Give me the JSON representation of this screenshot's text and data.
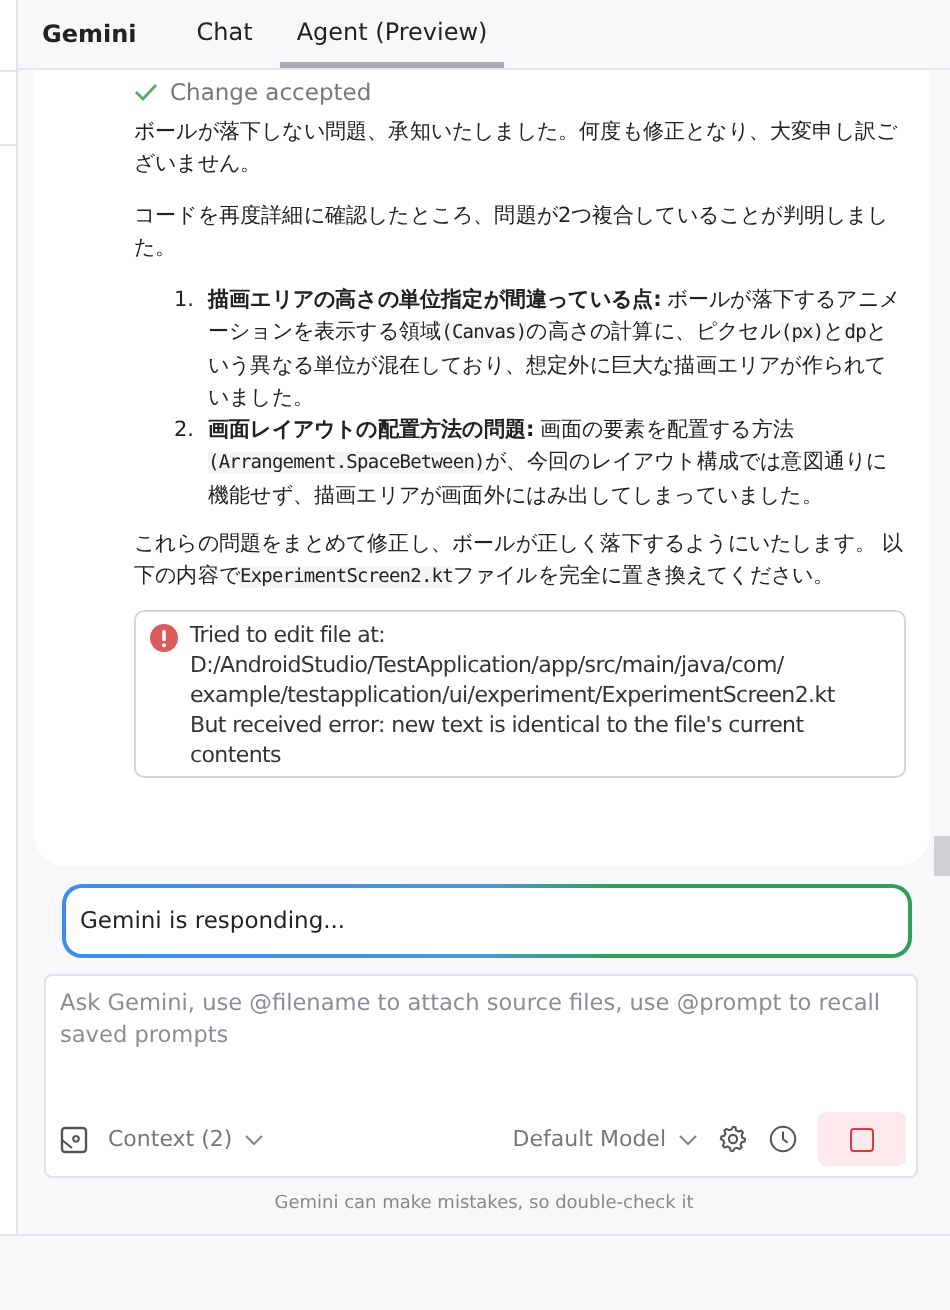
{
  "panel_title": "Gemini",
  "tabs": [
    {
      "label": "Chat",
      "selected": false
    },
    {
      "label": "Agent (Preview)",
      "selected": true
    }
  ],
  "status": {
    "kind": "success",
    "text": "Change accepted"
  },
  "blocks": [
    {
      "kind": "paragraph",
      "segments": [
        {
          "kind": "text",
          "text": "ボールが落下しない問題、承知いたしました。何度も修正となり、大変申し訳ございません。"
        }
      ]
    },
    {
      "kind": "paragraph",
      "segments": [
        {
          "kind": "text",
          "text": "コードを再度詳細に確認したところ、問題が2つ複合していることが判明しました。"
        }
      ]
    },
    {
      "kind": "list",
      "items": [
        {
          "number": "1.",
          "segments": [
            {
              "kind": "text",
              "text": "**描画エリアの高さの単位指定が間違っている点:** ボールが落下するアニメーションを表示する領域"
            },
            {
              "kind": "code",
              "text": "(Canvas)"
            },
            {
              "kind": "text",
              "text": "の高さの計算に、ピクセル"
            },
            {
              "kind": "code",
              "text": "(px)"
            },
            {
              "kind": "text",
              "text": "と"
            },
            {
              "kind": "code",
              "text": "dp"
            },
            {
              "kind": "text",
              "text": "という異なる単位が混在しており、想定外に巨大な描画エリアが作られていました。"
            }
          ]
        },
        {
          "number": "2.",
          "segments": [
            {
              "kind": "text",
              "text": "**画面レイアウトの配置方法の問題:** 画面の要素を配置する方法"
            },
            {
              "kind": "code",
              "text": "(Arrangement.SpaceBetween)"
            },
            {
              "kind": "text",
              "text": "が、今回のレイアウト構成では意図通りに機能せず、描画エリアが画面外にはみ出してしまっていました。"
            }
          ]
        }
      ]
    },
    {
      "kind": "paragraph",
      "segments": [
        {
          "kind": "text",
          "text": "これらの問題をまとめて修正し、ボールが正しく落下するようにいたします。 以下の内容で"
        },
        {
          "kind": "code",
          "text": "ExperimentScreen2.kt"
        },
        {
          "kind": "text",
          "text": "ファイルを完全に置き換えてください。"
        }
      ]
    },
    {
      "kind": "error",
      "lines": [
        "Tried to edit file at:",
        "D:/AndroidStudio/TestApplication/app/src/main/java/com/",
        "example/testapplication/ui/experiment/ExperimentScreen2.kt",
        "But received error: new text is identical to the file's current contents"
      ]
    }
  ],
  "responding": "Gemini is responding...",
  "composer": {
    "placeholder": "Ask Gemini, use @filename to attach source files, use @prompt to recall saved prompts",
    "context": "Context (2)",
    "model": "Default Model",
    "busy": true
  },
  "disclaimer": "Gemini can make mistakes, so double-check it"
}
